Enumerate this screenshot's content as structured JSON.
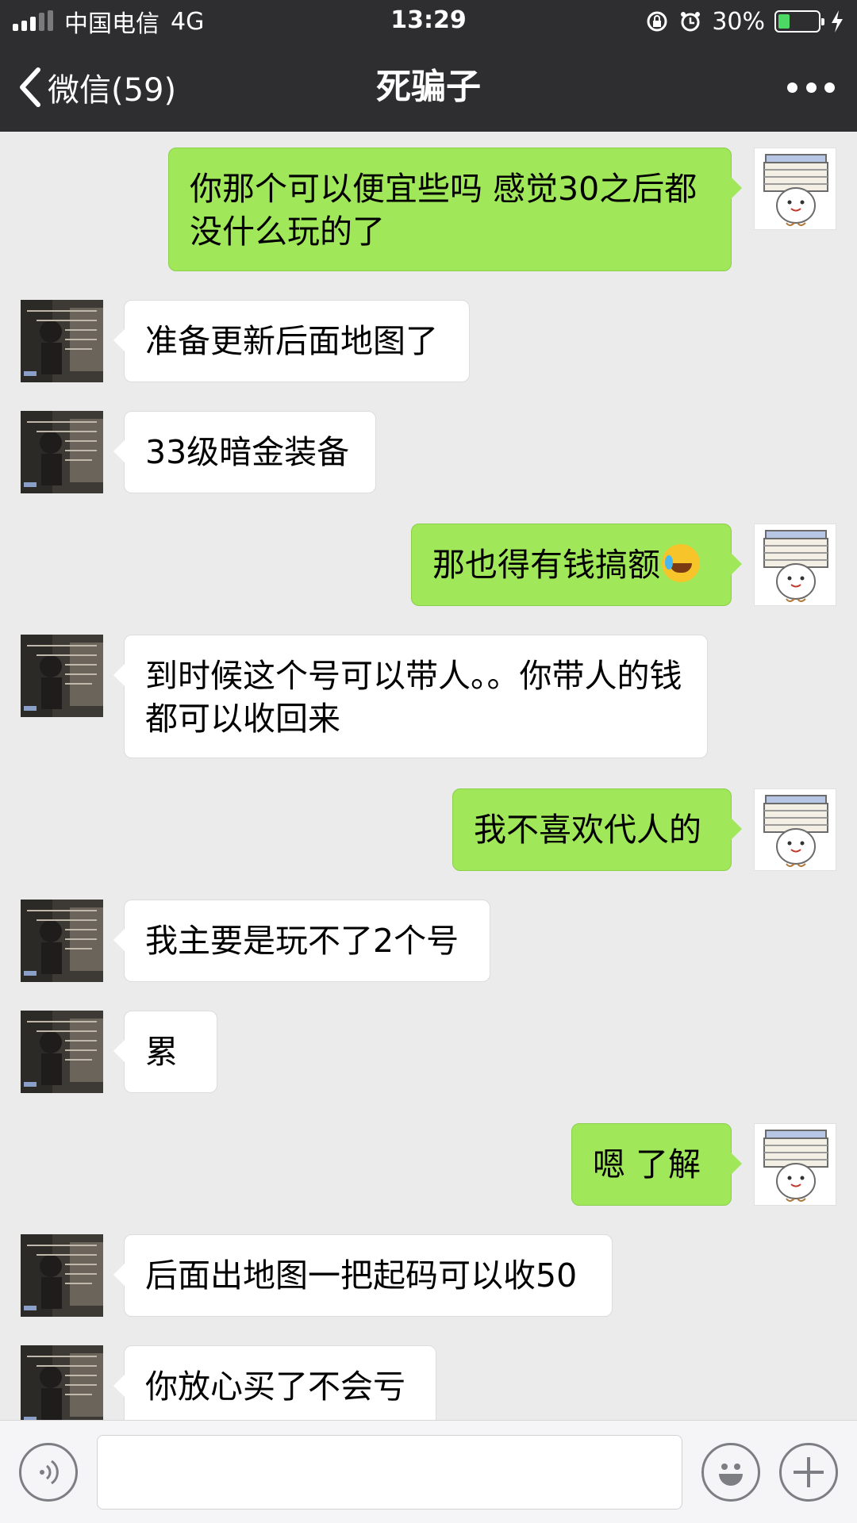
{
  "status_bar": {
    "carrier": "中国电信",
    "network": "4G",
    "time": "13:29",
    "battery_percent": "30%",
    "battery_level": 0.3
  },
  "nav": {
    "back_label": "微信(59)",
    "title": "死骗子",
    "more_icon": "more-dots-icon"
  },
  "messages": [
    {
      "side": "self",
      "text": "你那个可以便宜些吗 感觉30之后都没什么玩的了"
    },
    {
      "side": "other",
      "text": "准备更新后面地图了"
    },
    {
      "side": "other",
      "text": "33级暗金装备"
    },
    {
      "side": "self",
      "text": "那也得有钱搞额",
      "emoji": "crying-laughing-emoji"
    },
    {
      "side": "other",
      "text": "到时候这个号可以带人。。你带人的钱都可以收回来"
    },
    {
      "side": "self",
      "text": "我不喜欢代人的"
    },
    {
      "side": "other",
      "text": "我主要是玩不了2个号"
    },
    {
      "side": "other",
      "text": "累"
    },
    {
      "side": "self",
      "text": "嗯 了解"
    },
    {
      "side": "other",
      "text": "后面出地图一把起码可以收50"
    },
    {
      "side": "other",
      "text": "你放心买了不会亏"
    }
  ],
  "input_bar": {
    "voice_icon": "voice-icon",
    "emoji_icon": "emoji-icon",
    "plus_icon": "plus-icon",
    "text_value": ""
  },
  "colors": {
    "header_bg": "#2e2e30",
    "chat_bg": "#ebebeb",
    "self_bubble": "#a0e75a",
    "other_bubble": "#ffffff"
  }
}
